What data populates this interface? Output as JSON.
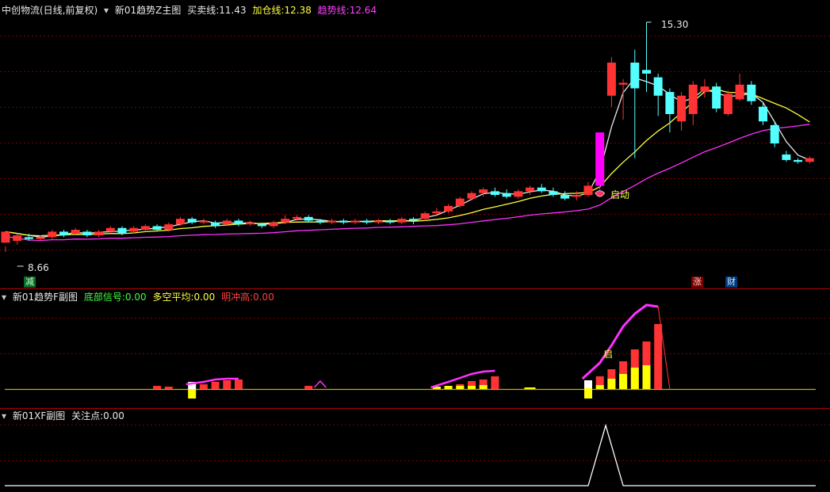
{
  "main_panel": {
    "stock": "中创物流(日线,前复权)",
    "indicator": "新01趋势Z主图",
    "items": [
      {
        "label": "买卖线:",
        "value": "11.43",
        "color": "#e8e8e8"
      },
      {
        "label": "加仓线:",
        "value": "12.38",
        "color": "#ffff40"
      },
      {
        "label": "趋势线:",
        "value": "12.64",
        "color": "#ff40ff"
      }
    ],
    "high_label": "15.30",
    "low_label": "8.66",
    "signal_start": "启动",
    "marker_reduce": "减",
    "marker_rise": "涨",
    "marker_finance": "财"
  },
  "sub_panel_f": {
    "indicator": "新01趋势F副图",
    "items": [
      {
        "label": "底部信号:",
        "value": "0.00",
        "color": "#40ff40"
      },
      {
        "label": "多空平均:",
        "value": "0.00",
        "color": "#ffff40"
      },
      {
        "label": "明冲高:",
        "value": "0.00",
        "color": "#ff4040"
      }
    ],
    "signal_char": "启"
  },
  "sub_panel_xf": {
    "indicator": "新01XF副图",
    "items": [
      {
        "label": "关注点:",
        "value": "0.00",
        "color": "#e8e8e8"
      }
    ]
  },
  "colors": {
    "up": "#ff3333",
    "down": "#54ffff",
    "magenta": "#ff00ff",
    "grid": "#7a0000"
  },
  "chart_data": {
    "type": "candlestick",
    "candles": [
      [
        9.3,
        9.6,
        9.2,
        9.05
      ],
      [
        9.35,
        9.5,
        9.55,
        9.25
      ],
      [
        9.45,
        9.4,
        9.55,
        9.35
      ],
      [
        9.4,
        9.45,
        9.5,
        9.35
      ],
      [
        9.45,
        9.6,
        9.65,
        9.4
      ],
      [
        9.6,
        9.5,
        9.65,
        9.45
      ],
      [
        9.55,
        9.65,
        9.7,
        9.5
      ],
      [
        9.6,
        9.5,
        9.65,
        9.45
      ],
      [
        9.5,
        9.6,
        9.65,
        9.45
      ],
      [
        9.6,
        9.7,
        9.75,
        9.55
      ],
      [
        9.7,
        9.55,
        9.75,
        9.5
      ],
      [
        9.6,
        9.7,
        9.75,
        9.55
      ],
      [
        9.65,
        9.75,
        9.8,
        9.6
      ],
      [
        9.75,
        9.65,
        9.8,
        9.6
      ],
      [
        9.65,
        9.8,
        9.85,
        9.6
      ],
      [
        9.8,
        9.95,
        10.0,
        9.75
      ],
      [
        9.95,
        9.85,
        10.0,
        9.8
      ],
      [
        9.85,
        9.9,
        9.95,
        9.8
      ],
      [
        9.85,
        9.75,
        9.9,
        9.7
      ],
      [
        9.8,
        9.9,
        9.95,
        9.75
      ],
      [
        9.9,
        9.8,
        9.95,
        9.75
      ],
      [
        9.8,
        9.85,
        9.9,
        9.75
      ],
      [
        9.8,
        9.75,
        9.85,
        9.7
      ],
      [
        9.75,
        9.85,
        9.9,
        9.7
      ],
      [
        9.85,
        9.95,
        10.05,
        9.8
      ],
      [
        9.95,
        10.0,
        10.05,
        9.9
      ],
      [
        10.0,
        9.9,
        10.05,
        9.85
      ],
      [
        9.9,
        9.85,
        9.95,
        9.8
      ],
      [
        9.85,
        9.9,
        9.95,
        9.8
      ],
      [
        9.9,
        9.85,
        9.95,
        9.8
      ],
      [
        9.85,
        9.9,
        9.95,
        9.8
      ],
      [
        9.9,
        9.85,
        9.95,
        9.8
      ],
      [
        9.85,
        9.9,
        9.95,
        9.8
      ],
      [
        9.9,
        9.85,
        9.95,
        9.8
      ],
      [
        9.85,
        9.95,
        10.0,
        9.8
      ],
      [
        9.95,
        9.9,
        10.0,
        9.8
      ],
      [
        9.95,
        10.1,
        10.15,
        9.9
      ],
      [
        10.1,
        10.15,
        10.25,
        10.05
      ],
      [
        10.15,
        10.3,
        10.35,
        10.1
      ],
      [
        10.3,
        10.5,
        10.55,
        10.25
      ],
      [
        10.5,
        10.65,
        10.7,
        10.45
      ],
      [
        10.65,
        10.75,
        10.8,
        10.55
      ],
      [
        10.7,
        10.6,
        10.8,
        10.55
      ],
      [
        10.65,
        10.55,
        10.75,
        10.5
      ],
      [
        10.55,
        10.7,
        10.75,
        10.5
      ],
      [
        10.7,
        10.8,
        10.85,
        10.6
      ],
      [
        10.8,
        10.7,
        10.9,
        10.65
      ],
      [
        10.7,
        10.6,
        10.8,
        10.55
      ],
      [
        10.6,
        10.5,
        10.7,
        10.45
      ],
      [
        10.55,
        10.6,
        10.7,
        10.45
      ],
      [
        10.6,
        10.85,
        10.95,
        10.55
      ],
      [
        10.85,
        12.3,
        12.3,
        10.7
      ],
      [
        13.3,
        14.2,
        14.35,
        13.0
      ],
      [
        13.6,
        13.65,
        13.75,
        12.65
      ],
      [
        14.2,
        13.5,
        14.55,
        11.6
      ],
      [
        14.0,
        13.9,
        15.3,
        13.4
      ],
      [
        13.8,
        13.3,
        13.9,
        12.75
      ],
      [
        13.4,
        12.8,
        13.5,
        12.3
      ],
      [
        12.6,
        13.3,
        13.4,
        12.35
      ],
      [
        12.8,
        13.6,
        13.7,
        12.5
      ],
      [
        13.4,
        13.55,
        13.75,
        13.25
      ],
      [
        13.55,
        12.95,
        13.65,
        12.85
      ],
      [
        12.8,
        13.35,
        13.45,
        12.75
      ],
      [
        13.2,
        13.6,
        13.9,
        13.15
      ],
      [
        13.6,
        13.15,
        13.7,
        13.05
      ],
      [
        13.0,
        12.6,
        13.1,
        12.5
      ],
      [
        12.5,
        12.0,
        12.6,
        11.9
      ],
      [
        11.7,
        11.55,
        11.8,
        11.5
      ],
      [
        11.55,
        11.5,
        11.6,
        11.45
      ],
      [
        11.5,
        11.6,
        11.65,
        11.45
      ]
    ],
    "candle_format": [
      "open",
      "close",
      "high",
      "low"
    ],
    "price_high": 15.3,
    "price_low": 8.66
  }
}
